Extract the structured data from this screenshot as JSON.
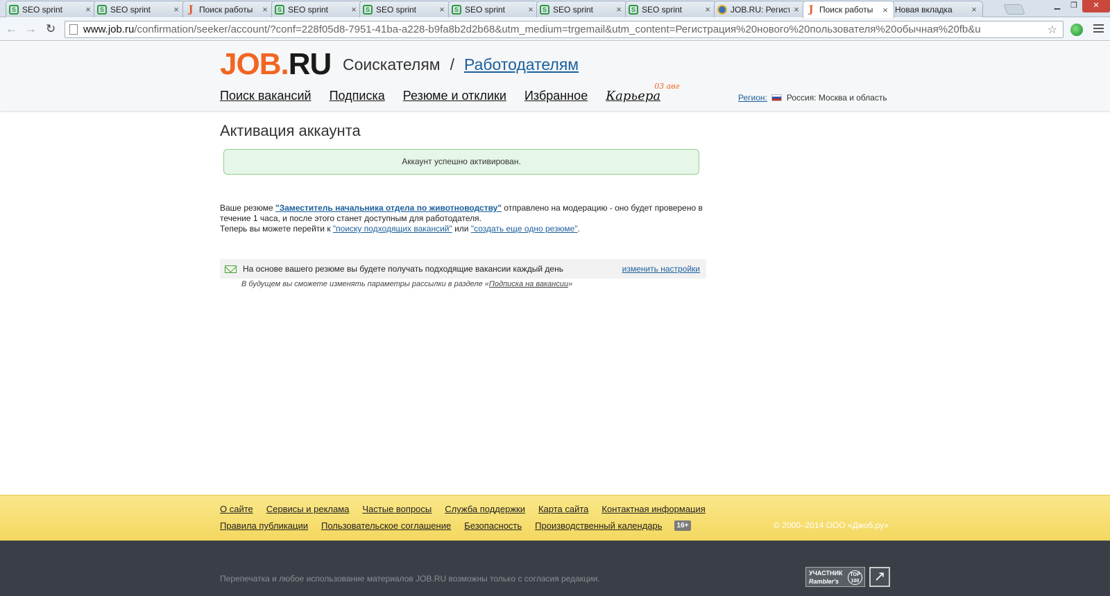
{
  "browser": {
    "tabs": [
      {
        "label": "SEO sprint",
        "icon": "seo-sprint-icon",
        "active": false
      },
      {
        "label": "SEO sprint",
        "icon": "seo-sprint-icon",
        "active": false
      },
      {
        "label": "Поиск работы",
        "icon": "jobru-icon",
        "active": false
      },
      {
        "label": "SEO sprint",
        "icon": "seo-sprint-icon",
        "active": false
      },
      {
        "label": "SEO sprint",
        "icon": "seo-sprint-icon",
        "active": false
      },
      {
        "label": "SEO sprint",
        "icon": "seo-sprint-icon",
        "active": false
      },
      {
        "label": "SEO sprint",
        "icon": "seo-sprint-icon",
        "active": false
      },
      {
        "label": "SEO sprint",
        "icon": "seo-sprint-icon",
        "active": false
      },
      {
        "label": "JOB.RU: Регистрация",
        "icon": "globe-icon",
        "active": false
      },
      {
        "label": "Поиск работы",
        "icon": "jobru-icon",
        "active": true
      },
      {
        "label": "Новая вкладка",
        "icon": "",
        "active": false
      }
    ],
    "close_glyph": "×",
    "url_host": "www.job.ru",
    "url_rest": "/confirmation/seeker/account/?conf=228f05d8-7951-41ba-a228-b9fa8b2d2b68&utm_medium=trgemail&utm_content=Регистрация%20нового%20пользователя%20обычная%20fb&u"
  },
  "header": {
    "logo_job": "JOB",
    "logo_dot": ".",
    "logo_ru": "RU",
    "seekers": "Соискателям",
    "separator": "/",
    "employers": "Работодателям",
    "nav": [
      "Поиск вакансий",
      "Подписка",
      "Резюме и отклики",
      "Избранное"
    ],
    "career": "Карьера",
    "career_badge": "03 авг",
    "region_label": "Регион:",
    "region_value": "Россия: Москва и область"
  },
  "main": {
    "title": "Активация аккаунта",
    "success_message": "Аккаунт успешно активирован.",
    "info_prefix": "Ваше резюме ",
    "resume_link": "\"Заместитель начальника отдела по животноводству\"",
    "info_middle": " отправлено на модерацию - оно будет проверено в течение 1 часа, и после этого станет доступным для работодателя.",
    "info_line2_prefix": "Теперь вы можете перейти к ",
    "search_link": "\"поиску подходящих вакансий\"",
    "info_or": " или ",
    "create_link": "\"создать еще одно резюме\"",
    "info_end": ".",
    "subscription_text": "На основе вашего резюме вы будете получать подходящие вакансии каждый день",
    "subscription_link": "изменить настройки",
    "note_prefix": "В будущем вы сможете изменять параметры рассылки в разделе «",
    "note_link": "Подписка на вакансии",
    "note_suffix": "»"
  },
  "footer": {
    "row1": [
      "О сайте",
      "Сервисы и реклама",
      "Частые вопросы",
      "Служба поддержки",
      "Карта сайта",
      "Контактная информация"
    ],
    "row2": [
      "Правила публикации",
      "Пользовательское соглашение",
      "Безопасность",
      "Производственный календарь"
    ],
    "age": "16+",
    "copyright": "© 2000–2014 ООО «Джоб.ру»",
    "reprint": "Перепечатка и любое использование материалов JOB.RU возможны только с согласия редакции.",
    "rambler_line1": "УЧАСТНИК",
    "rambler_line2": "Rambler's",
    "rambler_top": "TOP 100",
    "arrow_glyph": "↗"
  },
  "colors": {
    "brand_orange": "#f26522",
    "link_blue": "#1a5f9c",
    "success_bg": "#e6f6e8",
    "footer_yellow": "#f3d85f",
    "footer_dark": "#3a3f47"
  }
}
